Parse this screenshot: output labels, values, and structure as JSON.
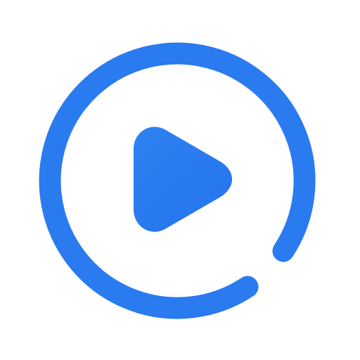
{
  "icon": {
    "name": "play-circle-icon",
    "colors": {
      "ring": "#2a7af0",
      "play_light": "#2d82f2",
      "play_dark": "#2573ec",
      "background": "#ffffff"
    }
  }
}
